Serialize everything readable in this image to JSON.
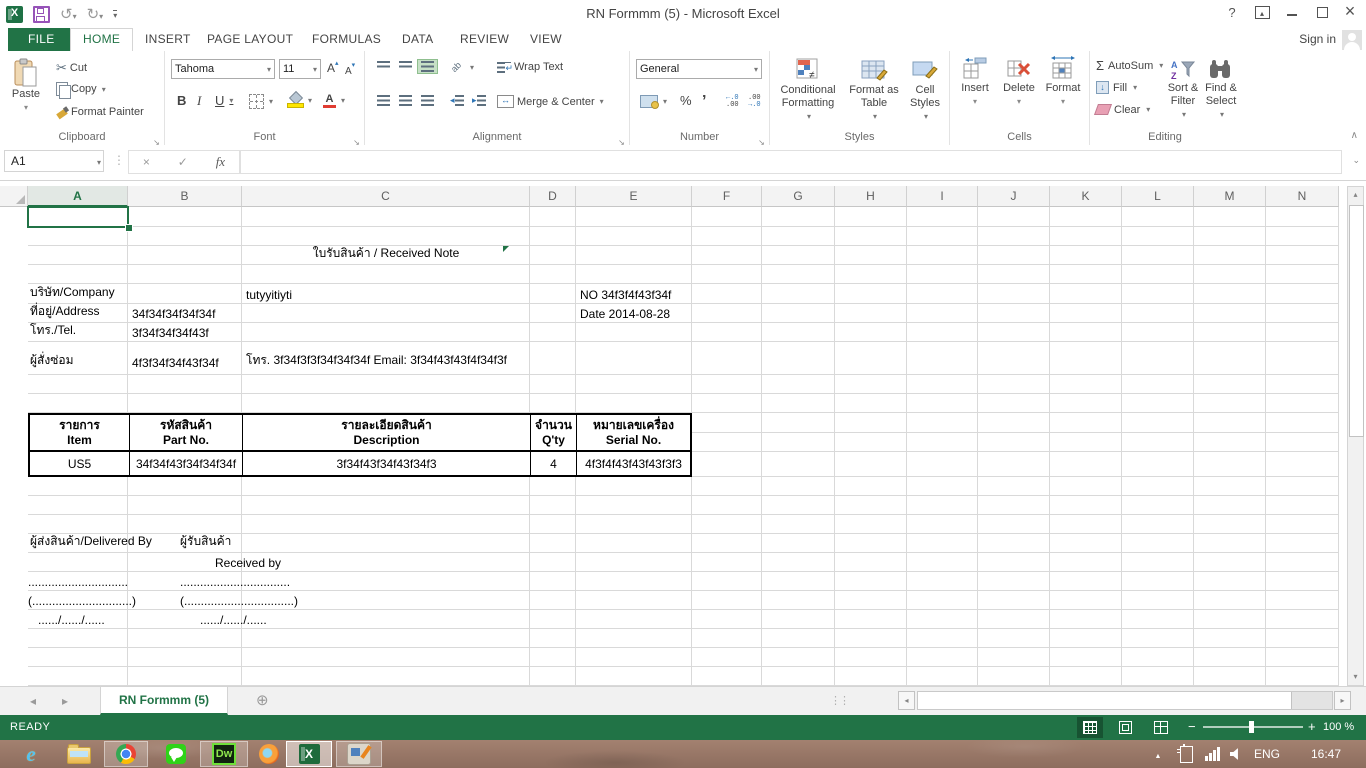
{
  "titlebar": {
    "title": "RN Formmm (5) - Microsoft Excel"
  },
  "tabs": {
    "file": "FILE",
    "home": "HOME",
    "insert": "INSERT",
    "page_layout": "PAGE LAYOUT",
    "formulas": "FORMULAS",
    "data": "DATA",
    "review": "REVIEW",
    "view": "VIEW",
    "sign_in": "Sign in"
  },
  "ribbon": {
    "clipboard": {
      "group": "Clipboard",
      "paste": "Paste",
      "cut": "Cut",
      "copy": "Copy",
      "format_painter": "Format Painter"
    },
    "font": {
      "group": "Font",
      "family": "Tahoma",
      "size": "11",
      "bold": "B",
      "italic": "I",
      "underline": "U"
    },
    "alignment": {
      "group": "Alignment",
      "wrap_text": "Wrap Text",
      "merge_center": "Merge & Center"
    },
    "number": {
      "group": "Number",
      "format": "General"
    },
    "styles": {
      "group": "Styles",
      "conditional": "Conditional Formatting",
      "format_table": "Format as Table",
      "cell_styles": "Cell Styles"
    },
    "cells": {
      "group": "Cells",
      "insert": "Insert",
      "delete": "Delete",
      "format": "Format"
    },
    "editing": {
      "group": "Editing",
      "autosum": "AutoSum",
      "fill": "Fill",
      "clear": "Clear",
      "sort_filter": "Sort & Filter",
      "find_select": "Find & Select"
    }
  },
  "formula_bar": {
    "name_box": "A1",
    "fx": "fx"
  },
  "grid": {
    "columns": [
      "A",
      "B",
      "C",
      "D",
      "E",
      "F",
      "G",
      "H",
      "I",
      "J",
      "K",
      "L",
      "M",
      "N"
    ],
    "row_count": 24,
    "cells": {
      "doc_title": "ใบรับสินค้า / Received Note",
      "company_label": "บริษัท/Company",
      "company_value": "tutyyitiyti",
      "no_value": "NO 34f3f4f43f34f",
      "address_label": "ที่อยู่/Address",
      "address_value": "34f34f34f34f34f",
      "date_value": "Date 2014-08-28",
      "tel_label": "โทร./Tel.",
      "tel_value": "3f34f34f34f43f",
      "orderer_label": "ผู้สั่งซ่อม",
      "orderer_value": "4f3f34f34f43f34f",
      "orderer_contact": "โทร. 3f34f3f3f34f34f34f Email: 3f34f43f43f4f34f3f",
      "delivered_by": "ผู้ส่งสินค้า/Delivered By",
      "received_by_th": "ผู้รับสินค้า",
      "received_by_en": "Received by",
      "sign_line_1": "..............................",
      "sign_line_2": ".................................",
      "sign_paren_1": "(..............................)",
      "sign_paren_2": "(.................................)",
      "date_line_1": "....../....../......",
      "date_line_2": "....../....../......"
    },
    "table": {
      "th": [
        "รายการ",
        "รหัสสินค้า",
        "รายละเอียดสินค้า",
        "จำนวน",
        "หมายเลขเครื่อง"
      ],
      "en": [
        "Item",
        "Part No.",
        "Description",
        "Q'ty",
        "Serial No."
      ],
      "row": [
        "US5",
        "34f34f43f34f34f34f",
        "3f34f43f34f43f34f3",
        "4",
        "4f3f4f43f43f43f3f3"
      ]
    }
  },
  "sheet_bar": {
    "tab": "RN Formmm (5)"
  },
  "status_bar": {
    "mode": "READY",
    "zoom": "100 %"
  },
  "taskbar": {
    "lang": "ENG",
    "time": "16:47"
  },
  "colors": {
    "accent": "#217346",
    "fill_yellow": "#ffe600",
    "font_red": "#e03c32"
  }
}
